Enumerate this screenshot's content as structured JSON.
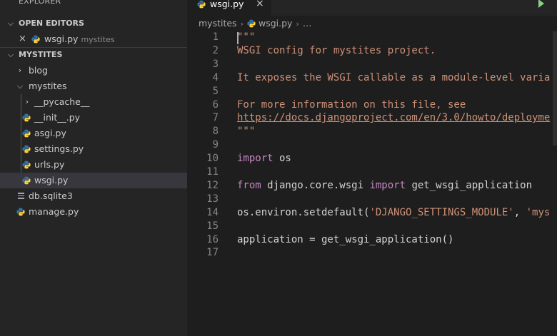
{
  "sidebar": {
    "title": "EXPLORER",
    "open_editors": {
      "label": "OPEN EDITORS",
      "items": [
        {
          "name": "wsgi.py",
          "folder": "mystites",
          "close": "×"
        }
      ]
    },
    "project": {
      "label": "MYSTITES",
      "tree": [
        {
          "label": "blog",
          "type": "folder",
          "collapsed": true
        },
        {
          "label": "mystites",
          "type": "folder",
          "collapsed": false
        },
        {
          "label": "__pycache__",
          "type": "folder",
          "collapsed": true
        },
        {
          "label": "__init__.py",
          "type": "python"
        },
        {
          "label": "asgi.py",
          "type": "python"
        },
        {
          "label": "settings.py",
          "type": "python"
        },
        {
          "label": "urls.py",
          "type": "python"
        },
        {
          "label": "wsgi.py",
          "type": "python",
          "active": true
        },
        {
          "label": "db.sqlite3",
          "type": "database"
        },
        {
          "label": "manage.py",
          "type": "python"
        }
      ]
    }
  },
  "editor": {
    "tab": {
      "label": "wsgi.py",
      "close": "×"
    },
    "breadcrumb": [
      "mystites",
      "wsgi.py",
      "…"
    ],
    "lines": [
      {
        "n": "1",
        "text": "\"\"\""
      },
      {
        "n": "2",
        "text": "WSGI config for mystites project."
      },
      {
        "n": "3",
        "text": ""
      },
      {
        "n": "4",
        "text": "It exposes the WSGI callable as a module-level varia"
      },
      {
        "n": "5",
        "text": ""
      },
      {
        "n": "6",
        "text": "For more information on this file, see"
      },
      {
        "n": "7",
        "text": "https://docs.djangoproject.com/en/3.0/howto/deployme"
      },
      {
        "n": "8",
        "text": "\"\"\""
      },
      {
        "n": "9",
        "text": ""
      },
      {
        "n": "10",
        "text": "import os"
      },
      {
        "n": "11",
        "text": ""
      },
      {
        "n": "12",
        "text": "from django.core.wsgi import get_wsgi_application"
      },
      {
        "n": "13",
        "text": ""
      },
      {
        "n": "14",
        "text": "os.environ.setdefault('DJANGO_SETTINGS_MODULE', 'mys"
      },
      {
        "n": "15",
        "text": ""
      },
      {
        "n": "16",
        "text": "application = get_wsgi_application()"
      },
      {
        "n": "17",
        "text": ""
      }
    ]
  },
  "colors": {
    "sidebar_bg": "#252526",
    "editor_bg": "#1e1e1e",
    "string": "#ce9178",
    "keyword": "#c586c0",
    "line_number": "#858585",
    "run_icon": "#89d185",
    "python_icon_blue": "#3572a5",
    "python_icon_yellow": "#ffd43b"
  },
  "icons": [
    "close-icon",
    "chevron-down-icon",
    "chevron-right-icon",
    "python-file-icon",
    "database-file-icon",
    "run-icon"
  ]
}
